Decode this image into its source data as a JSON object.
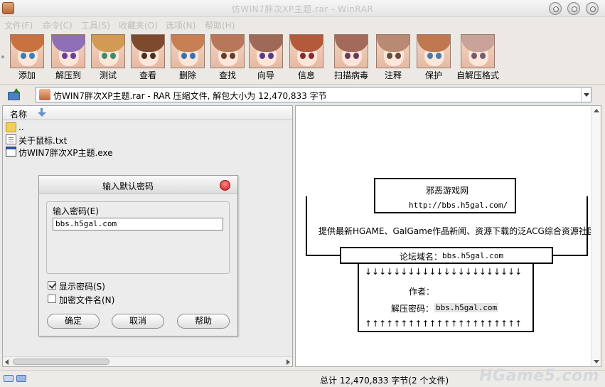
{
  "window": {
    "title": "仿WIN7胖次XP主题.rar - WinRAR"
  },
  "menu": [
    "文件(F)",
    "命令(C)",
    "工具(S)",
    "收藏夹(O)",
    "选项(N)",
    "帮助(H)"
  ],
  "toolbar": [
    {
      "label": "添加",
      "icon": "add-icon",
      "hair": "#c8733f",
      "eye": "#3a7fb8"
    },
    {
      "label": "解压到",
      "icon": "extract-to-icon",
      "hair": "#8f6fb8",
      "eye": "#6a3f9c"
    },
    {
      "label": "测试",
      "icon": "test-icon",
      "hair": "#d29a52",
      "eye": "#3b8c6a"
    },
    {
      "label": "查看",
      "icon": "view-icon",
      "hair": "#7d4a2e",
      "eye": "#4a2f20"
    },
    {
      "label": "删除",
      "icon": "delete-icon",
      "hair": "#c77f53",
      "eye": "#3a6fb0"
    },
    {
      "label": "查找",
      "icon": "find-icon",
      "hair": "#b8765a",
      "eye": "#6b3a2a"
    },
    {
      "label": "向导",
      "icon": "wizard-icon",
      "hair": "#9e6a57",
      "eye": "#5a3a8a"
    },
    {
      "label": "信息",
      "icon": "info-icon",
      "hair": "#b35a3c",
      "eye": "#8a2a2a"
    },
    {
      "label": "扫描病毒",
      "icon": "virus-scan-icon",
      "hair": "#a36a5c",
      "eye": "#6a3a5a"
    },
    {
      "label": "注释",
      "icon": "comment-icon",
      "hair": "#b88a74",
      "eye": "#6a4a3a"
    },
    {
      "label": "保护",
      "icon": "protect-icon",
      "hair": "#c07850",
      "eye": "#4a7aa8"
    },
    {
      "label": "自解压格式",
      "icon": "sfx-icon",
      "hair": "#c9a39a",
      "eye": "#7a5a6a"
    }
  ],
  "address": {
    "text": "仿WIN7胖次XP主题.rar - RAR 压缩文件, 解包大小为 12,470,833 字节"
  },
  "filelist": {
    "column_name": "名称",
    "rows": [
      {
        "name": "..",
        "icon": "folder-icon"
      },
      {
        "name": "关于鼠标.txt",
        "icon": "text-file-icon"
      },
      {
        "name": "仿WIN7胖次XP主题.exe",
        "icon": "exe-file-icon"
      }
    ]
  },
  "dialog": {
    "title": "输入默认密码",
    "password_label": "输入密码(E)",
    "password_value": "bbs.h5gal.com",
    "show_password": "显示密码(S)",
    "show_password_checked": true,
    "encrypt_names": "加密文件名(N)",
    "encrypt_names_checked": false,
    "ok": "确定",
    "cancel": "取消",
    "help": "帮助"
  },
  "comment": {
    "site_name": "邪恶游戏网",
    "site_url": "http://bbs.h5gal.com/",
    "description": "提供最新HGAME、GalGame作品新闻、资源下载的泛ACG综合资源社区.",
    "forum_domain_label": "论坛域名：",
    "forum_domain": "bbs.h5gal.com",
    "arrows_down": "↓↓↓↓↓↓↓↓↓↓↓↓↓↓↓↓↓↓↓↓↓↓",
    "author_label": "作者：",
    "password_label": "解压密码：",
    "password": "bbs.h5gal.com",
    "arrows_up": "↑↑↑↑↑↑↑↑↑↑↑↑↑↑↑↑↑↑↑↑↑↑"
  },
  "status": {
    "total": "总计 12,470,833 字节(2 个文件)",
    "watermark": "HGame5.com"
  }
}
